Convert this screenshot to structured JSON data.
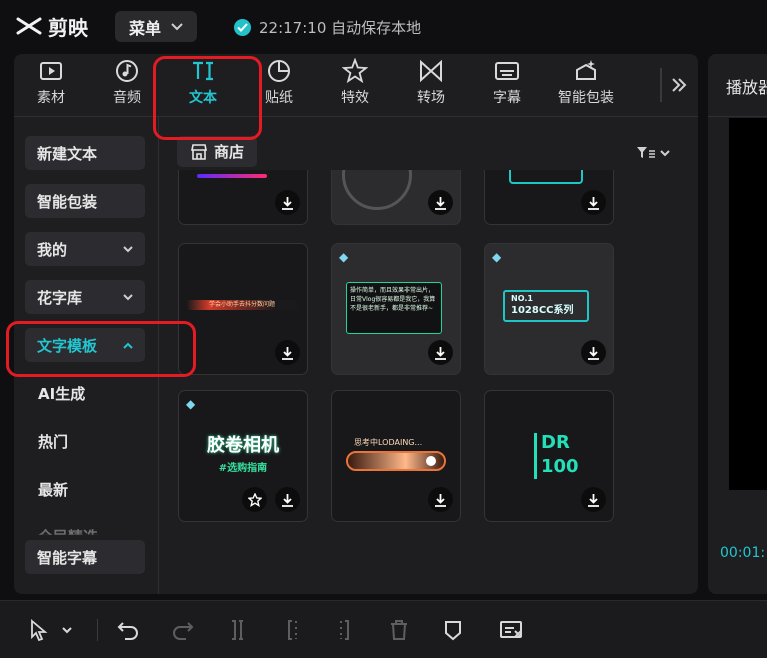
{
  "app": {
    "title": "剪映"
  },
  "header": {
    "menu_label": "菜单",
    "save_status": "22:17:10 自动保存本地"
  },
  "tabs": [
    {
      "label": "素材",
      "icon": "media-icon"
    },
    {
      "label": "音频",
      "icon": "audio-icon"
    },
    {
      "label": "文本",
      "icon": "text-icon",
      "active": true
    },
    {
      "label": "贴纸",
      "icon": "sticker-icon"
    },
    {
      "label": "特效",
      "icon": "effects-icon"
    },
    {
      "label": "转场",
      "icon": "transition-icon"
    },
    {
      "label": "字幕",
      "icon": "subtitle-icon"
    },
    {
      "label": "智能包装",
      "icon": "smart-package-icon"
    }
  ],
  "sidebar": {
    "new_text": "新建文本",
    "smart_package": "智能包装",
    "mine": "我的",
    "fancy_font": "花字库",
    "text_template": "文字模板",
    "ai_generate": "AI生成",
    "hot": "热门",
    "latest": "最新",
    "curated": "全民精选",
    "smart_subtitle": "智能字幕"
  },
  "content": {
    "store_label": "商店",
    "templates": [
      {
        "text": "学会小助手去抖分数问题"
      },
      {
        "text": "操作简单，而且效果非常出片，日常Vlog很容易都是我它，我算不是很老新手，都是非常推荐~",
        "premium": true
      },
      {
        "line1": "NO.1",
        "line2": "1028CC系列",
        "premium": true
      },
      {
        "line1": "胶卷相机",
        "line2": "#选购指南",
        "premium": true
      },
      {
        "text": "思考中LODAING..."
      },
      {
        "line1": "DR",
        "line2": "100"
      }
    ]
  },
  "preview": {
    "title": "播放器",
    "timecode": "00:01:"
  },
  "colors": {
    "accent": "#23c5d0",
    "highlight_box": "#e31b23",
    "panel": "#1e1e21",
    "background": "#0f0f11"
  }
}
